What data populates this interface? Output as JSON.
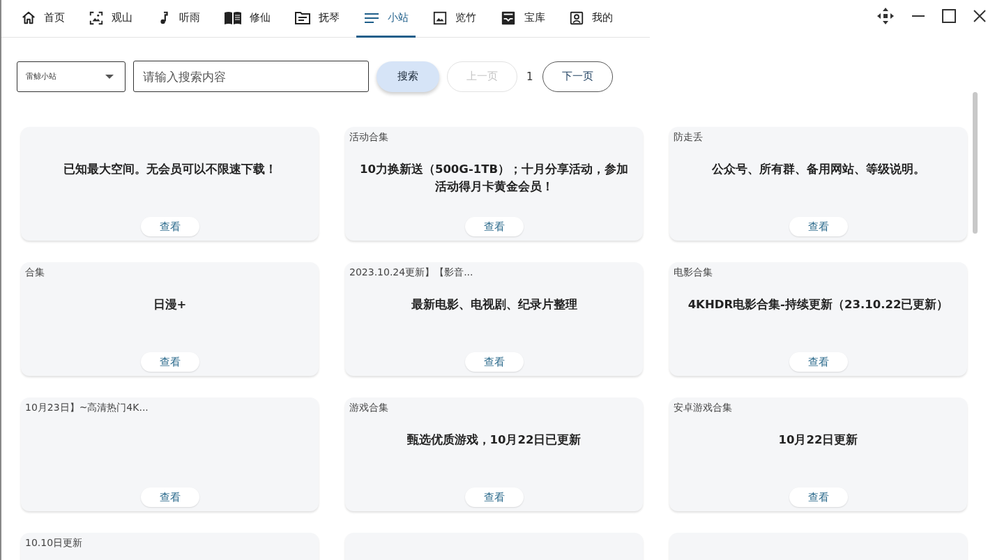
{
  "tabs": [
    {
      "label": "首页",
      "selected": false
    },
    {
      "label": "观山",
      "selected": false
    },
    {
      "label": "听雨",
      "selected": false
    },
    {
      "label": "修仙",
      "selected": false
    },
    {
      "label": "抚琴",
      "selected": false
    },
    {
      "label": "小站",
      "selected": true
    },
    {
      "label": "览竹",
      "selected": false
    },
    {
      "label": "宝库",
      "selected": false
    },
    {
      "label": "我的",
      "selected": false
    }
  ],
  "toolbar": {
    "source": "雷鲸小站",
    "search_placeholder": "请输入搜索内容",
    "search_button": "搜索",
    "prev_button": {
      "label": "上一页",
      "disabled": true
    },
    "page": "1",
    "next_button": {
      "label": "下一页",
      "disabled": false
    }
  },
  "cards": [
    {
      "kind": "card",
      "body": "已知最大空间。无会员可以不限速下载！",
      "action": "查看"
    },
    {
      "kind": "card",
      "title": "活动合集",
      "body": "10力换新送（500G-1TB）；十月分享活动，参加活动得月卡黄金会员！",
      "action": "查看"
    },
    {
      "kind": "card",
      "title": "防走丢",
      "body": "公众号、所有群、备用网站、等级说明。",
      "action": "查看"
    },
    {
      "kind": "card",
      "title": "合集",
      "body": "日漫+",
      "action": "查看"
    },
    {
      "kind": "card",
      "title": "2023.10.24更新】【影音...",
      "body": "最新电影、电视剧、纪录片整理",
      "action": "查看"
    },
    {
      "kind": "card",
      "title": "电影合集",
      "body": "4KHDR电影合集-持续更新（23.10.22已更新）",
      "action": "查看"
    },
    {
      "kind": "card",
      "title": "10月23日】~高清热门4K...",
      "action": "查看"
    },
    {
      "kind": "card",
      "title": "游戏合集",
      "body": "甄选优质游戏，10月22日已更新",
      "action": "查看"
    },
    {
      "kind": "card",
      "title": "安卓游戏合集",
      "body": "10月22日更新",
      "action": "查看"
    },
    {
      "kind": "card",
      "title": "10.10日更新"
    },
    {
      "kind": "card"
    },
    {
      "kind": "card"
    }
  ]
}
